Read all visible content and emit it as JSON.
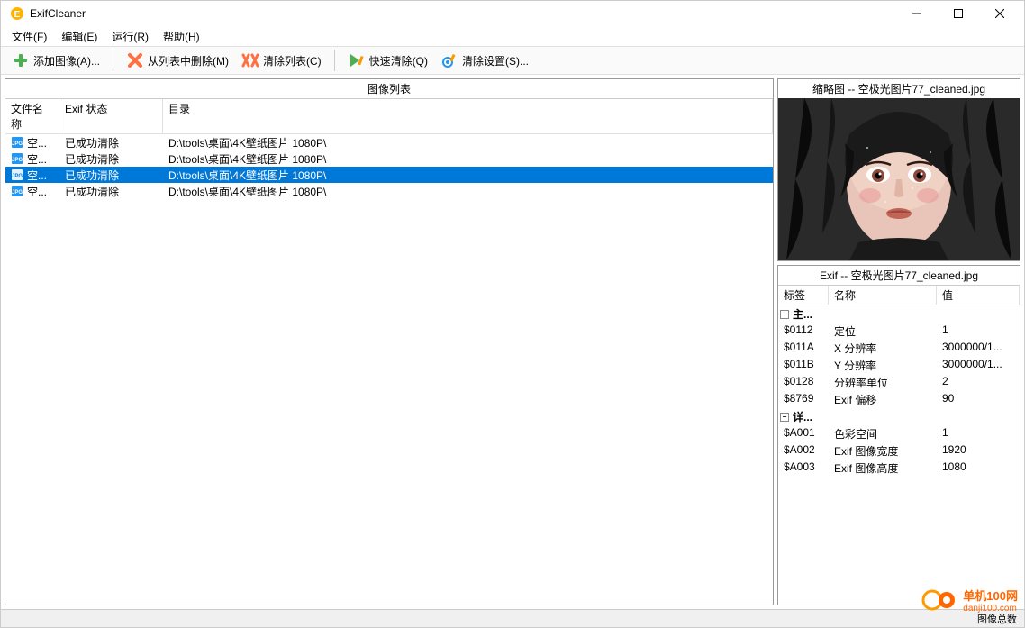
{
  "window": {
    "title": "ExifCleaner"
  },
  "menu": {
    "items": [
      {
        "label": "文件(F)"
      },
      {
        "label": "编辑(E)"
      },
      {
        "label": "运行(R)"
      },
      {
        "label": "帮助(H)"
      }
    ]
  },
  "toolbar": {
    "add": "添加图像(A)...",
    "remove": "从列表中删除(M)",
    "clear": "清除列表(C)",
    "quick": "快速清除(Q)",
    "settings": "清除设置(S)..."
  },
  "listPanel": {
    "title": "图像列表",
    "headers": {
      "file": "文件名称",
      "status": "Exif 状态",
      "dir": "目录"
    },
    "rows": [
      {
        "file": "空...",
        "status": "已成功清除",
        "dir": "D:\\tools\\桌面\\4K壁纸图片 1080P\\",
        "selected": false
      },
      {
        "file": "空...",
        "status": "已成功清除",
        "dir": "D:\\tools\\桌面\\4K壁纸图片 1080P\\",
        "selected": false
      },
      {
        "file": "空...",
        "status": "已成功清除",
        "dir": "D:\\tools\\桌面\\4K壁纸图片 1080P\\",
        "selected": true
      },
      {
        "file": "空...",
        "status": "已成功清除",
        "dir": "D:\\tools\\桌面\\4K壁纸图片 1080P\\",
        "selected": false
      }
    ]
  },
  "thumbnail": {
    "title": "缩略图 -- 空极光图片77_cleaned.jpg"
  },
  "exif": {
    "title": "Exif -- 空极光图片77_cleaned.jpg",
    "headers": {
      "tag": "标签",
      "name": "名称",
      "val": "值"
    },
    "groups": [
      {
        "label": "主...",
        "rows": [
          {
            "tag": "$0112",
            "name": "定位",
            "val": "1"
          },
          {
            "tag": "$011A",
            "name": "X 分辨率",
            "val": "3000000/1..."
          },
          {
            "tag": "$011B",
            "name": "Y 分辨率",
            "val": "3000000/1..."
          },
          {
            "tag": "$0128",
            "name": "分辨率单位",
            "val": "2"
          },
          {
            "tag": "$8769",
            "name": "Exif 偏移",
            "val": "90"
          }
        ]
      },
      {
        "label": "详...",
        "rows": [
          {
            "tag": "$A001",
            "name": "色彩空间",
            "val": "1"
          },
          {
            "tag": "$A002",
            "name": "Exif 图像宽度",
            "val": "1920"
          },
          {
            "tag": "$A003",
            "name": "Exif 图像高度",
            "val": "1080"
          }
        ]
      }
    ]
  },
  "statusBar": {
    "text": "图像总数"
  },
  "watermark": {
    "main": "单机100网",
    "sub": "danji100.com"
  }
}
